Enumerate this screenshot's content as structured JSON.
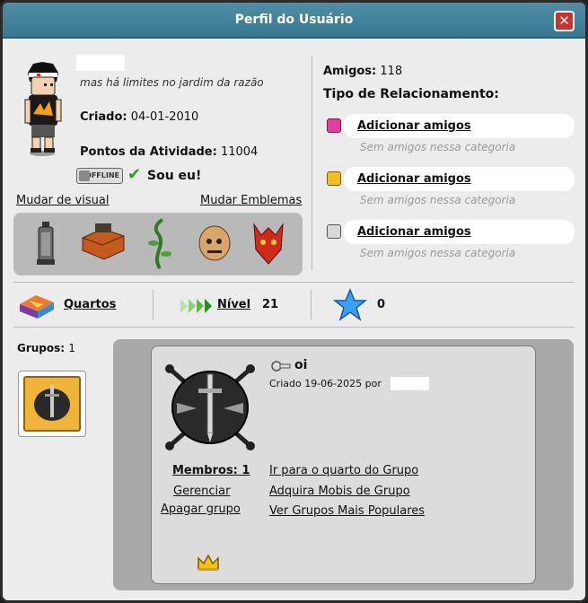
{
  "window": {
    "title": "Perfil do Usuário",
    "close_label": "✕"
  },
  "profile": {
    "motto": "mas há limites no jardim da razão",
    "created_label": "Criado:",
    "created_value": "04-01-2010",
    "points_label": "Pontos da Atividade:",
    "points_value": "11004",
    "offline_badge": "OFFLINE",
    "self_check": "✔",
    "self_label": "Sou eu!",
    "change_look": "Mudar de visual",
    "change_badges": "Mudar Emblemas"
  },
  "badges": [
    {
      "icon": "lantern-icon"
    },
    {
      "icon": "sofa-icon"
    },
    {
      "icon": "beanstalk-icon"
    },
    {
      "icon": "stone-head-icon"
    },
    {
      "icon": "red-dragon-icon"
    }
  ],
  "friends": {
    "count_label": "Amigos:",
    "count_value": "118",
    "relationship_title": "Tipo de Relacionamento:",
    "relationships": [
      {
        "icon": "heart-icon",
        "color": "#e0409a",
        "link": "Adicionar amigos",
        "empty": "Sem amigos nessa categoria"
      },
      {
        "icon": "smile-icon",
        "color": "#f0c020",
        "link": "Adicionar amigos",
        "empty": "Sem amigos nessa categoria"
      },
      {
        "icon": "skull-icon",
        "color": "#707070",
        "link": "Adicionar amigos",
        "empty": "Sem amigos nessa categoria"
      }
    ]
  },
  "stats": {
    "rooms_label": "Quartos",
    "level_label": "Nível",
    "level_value": "21",
    "stars_value": "0"
  },
  "groups": {
    "label": "Grupos:",
    "count": "1",
    "selected": {
      "name": "oi",
      "created": "Criado 19-06-2025 por",
      "members": "Membros: 1",
      "manage": "Gerenciar",
      "delete": "Apagar grupo",
      "links": [
        "Ir para o quarto do Grupo",
        "Adquira Mobis de Grupo",
        "Ver Grupos Mais Populares"
      ]
    }
  }
}
